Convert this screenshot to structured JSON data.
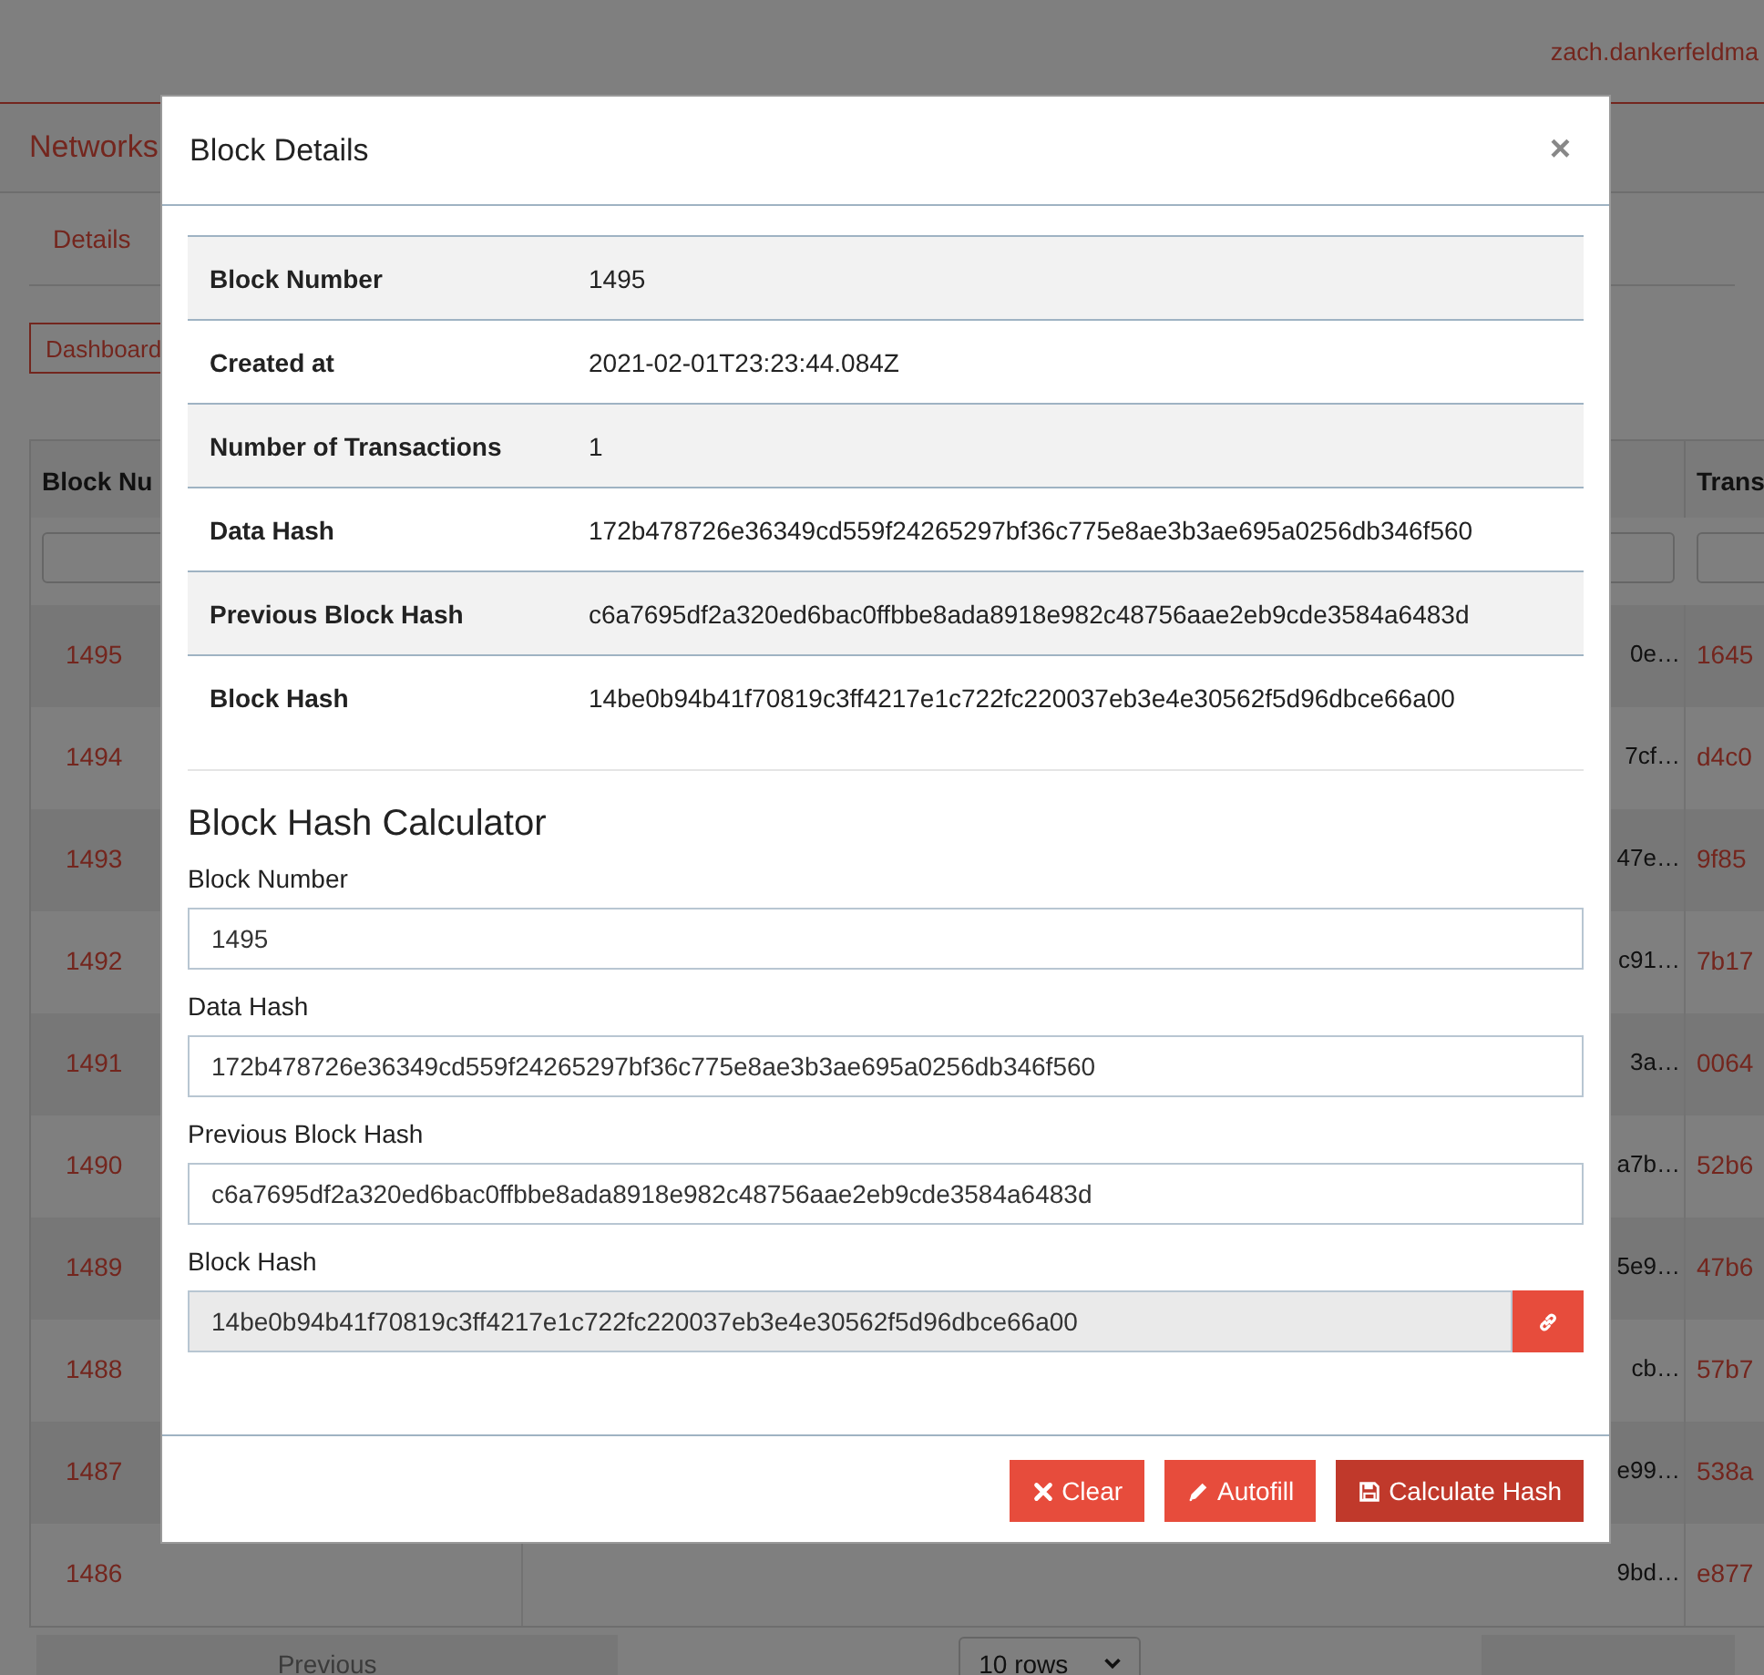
{
  "header": {
    "user": "zach.dankerfeldma"
  },
  "page": {
    "title": "Networks",
    "tabs": [
      {
        "label": "Details"
      }
    ],
    "dashboard_button": "Dashboard"
  },
  "table": {
    "columns": [
      "Block Nu",
      "Trans"
    ],
    "rows": [
      {
        "block_number": "1495",
        "column_2": "0e…",
        "column_3": "1645"
      },
      {
        "block_number": "1494",
        "column_2": "7cf…",
        "column_3": "d4c0"
      },
      {
        "block_number": "1493",
        "column_2": "47e…",
        "column_3": "9f85"
      },
      {
        "block_number": "1492",
        "column_2": "c91…",
        "column_3": "7b17"
      },
      {
        "block_number": "1491",
        "column_2": "3a…",
        "column_3": "0064"
      },
      {
        "block_number": "1490",
        "column_2": "a7b…",
        "column_3": "52b6"
      },
      {
        "block_number": "1489",
        "column_2": "5e9…",
        "column_3": "47b6"
      },
      {
        "block_number": "1488",
        "column_2": "cb…",
        "column_3": "57b7"
      },
      {
        "block_number": "1487",
        "column_2": "e99…",
        "column_3": "538a"
      },
      {
        "block_number": "1486",
        "column_2": "9bd…",
        "column_3": "e877"
      }
    ]
  },
  "pagination": {
    "previous": "Previous",
    "page_size": "10 rows"
  },
  "modal": {
    "title": "Block Details",
    "close": "×",
    "details": [
      {
        "label": "Block Number",
        "value": "1495"
      },
      {
        "label": "Created at",
        "value": "2021-02-01T23:23:44.084Z"
      },
      {
        "label": "Number of Transactions",
        "value": "1"
      },
      {
        "label": "Data Hash",
        "value": "172b478726e36349cd559f24265297bf36c775e8ae3b3ae695a0256db346f560"
      },
      {
        "label": "Previous Block Hash",
        "value": "c6a7695df2a320ed6bac0ffbbe8ada8918e982c48756aae2eb9cde3584a6483d"
      },
      {
        "label": "Block Hash",
        "value": "14be0b94b41f70819c3ff4217e1c722fc220037eb3e4e30562f5d96dbce66a00"
      }
    ],
    "calculator": {
      "title": "Block Hash Calculator",
      "fields": [
        {
          "label": "Block Number",
          "value": "1495",
          "readonly": false
        },
        {
          "label": "Data Hash",
          "value": "172b478726e36349cd559f24265297bf36c775e8ae3b3ae695a0256db346f560",
          "readonly": false
        },
        {
          "label": "Previous Block Hash",
          "value": "c6a7695df2a320ed6bac0ffbbe8ada8918e982c48756aae2eb9cde3584a6483d",
          "readonly": false
        },
        {
          "label": "Block Hash",
          "value": "14be0b94b41f70819c3ff4217e1c722fc220037eb3e4e30562f5d96dbce66a00",
          "readonly": true
        }
      ]
    },
    "buttons": [
      {
        "label": "Clear",
        "kind": "clear"
      },
      {
        "label": "Autofill",
        "kind": "autofill"
      },
      {
        "label": "Calculate Hash",
        "kind": "calculate"
      }
    ]
  }
}
